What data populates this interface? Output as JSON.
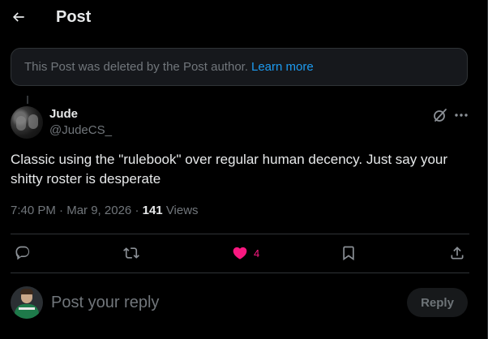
{
  "header": {
    "title": "Post",
    "back_icon": "arrow-left-icon"
  },
  "notice": {
    "text": "This Post was deleted by the Post author.",
    "link": "Learn more"
  },
  "post": {
    "author_name": "Jude",
    "author_handle": "@JudeCS_",
    "text": "Classic using the \"rulebook\" over regular human decency. Just say your shitty roster is desperate",
    "time": "7:40 PM",
    "separator": "·",
    "date": "Mar 9, 2026",
    "views_count": "141",
    "views_label": "Views",
    "like_count": "4"
  },
  "actions": [
    "reply-icon",
    "repost-icon",
    "like-icon",
    "bookmark-icon",
    "share-icon"
  ],
  "composer": {
    "placeholder": "Post your reply",
    "button_label": "Reply"
  },
  "colors": {
    "background": "#000000",
    "accent": "#1d9bf0",
    "like": "#f91880",
    "muted": "#71767b",
    "border": "#2f3336"
  }
}
